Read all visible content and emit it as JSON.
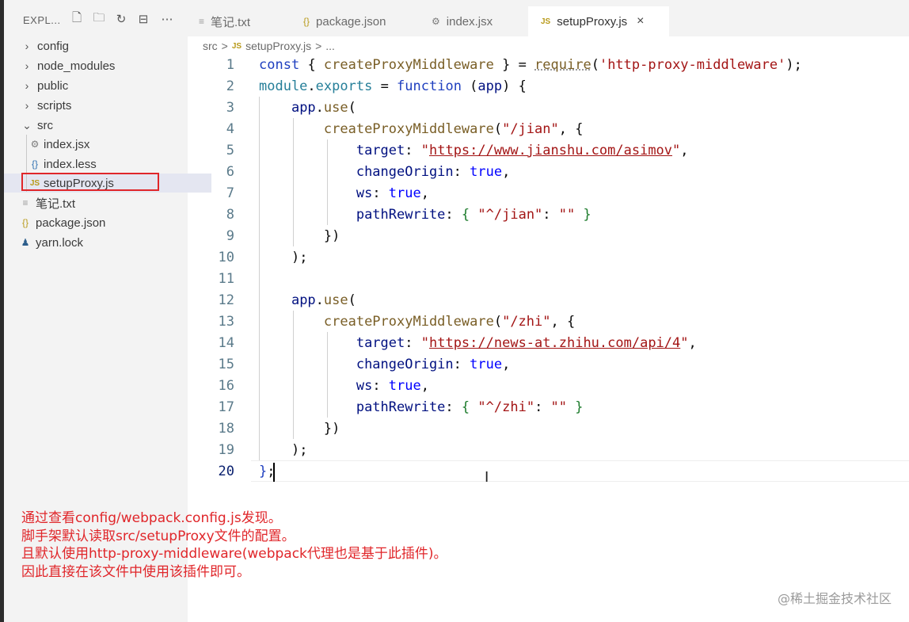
{
  "explorer": {
    "title": "EXPL...",
    "tree": [
      {
        "label": "config",
        "kind": "folder",
        "expanded": false
      },
      {
        "label": "node_modules",
        "kind": "folder",
        "expanded": false
      },
      {
        "label": "public",
        "kind": "folder",
        "expanded": false
      },
      {
        "label": "scripts",
        "kind": "folder",
        "expanded": false
      },
      {
        "label": "src",
        "kind": "folder",
        "expanded": true
      },
      {
        "label": "index.jsx",
        "kind": "file",
        "icon": "gear-icon"
      },
      {
        "label": "index.less",
        "kind": "file",
        "icon": "braces-icon"
      },
      {
        "label": "setupProxy.js",
        "kind": "file",
        "icon": "js-icon",
        "selected": true
      },
      {
        "label": "笔记.txt",
        "kind": "file",
        "icon": "text-file-icon"
      },
      {
        "label": "package.json",
        "kind": "file",
        "icon": "braces-icon"
      },
      {
        "label": "yarn.lock",
        "kind": "file",
        "icon": "yarn-icon"
      }
    ]
  },
  "tabs": [
    {
      "label": "笔记.txt",
      "icon": "text-file-icon"
    },
    {
      "label": "package.json",
      "icon": "braces-icon"
    },
    {
      "label": "index.jsx",
      "icon": "gear-icon"
    },
    {
      "label": "setupProxy.js",
      "icon": "js-icon",
      "active": true,
      "close": "×"
    }
  ],
  "breadcrumb": {
    "folder": "src",
    "sep": ">",
    "file": "setupProxy.js",
    "more": "..."
  },
  "code": {
    "lines": [
      "1",
      "2",
      "3",
      "4",
      "5",
      "6",
      "7",
      "8",
      "9",
      "10",
      "11",
      "12",
      "13",
      "14",
      "15",
      "16",
      "17",
      "18",
      "19",
      "20"
    ],
    "current_line": "20"
  },
  "notes": {
    "line1": "通过查看config/webpack.config.js发现。",
    "line2": "脚手架默认读取src/setupProxy文件的配置。",
    "line3": "且默认使用http-proxy-middleware(webpack代理也是基于此插件)。",
    "line4": "因此直接在该文件中使用该插件即可。"
  },
  "watermark": "@稀土掘金技术社区",
  "colors": {
    "highlight_box": "#e0262a",
    "note_text": "#e0262a"
  }
}
